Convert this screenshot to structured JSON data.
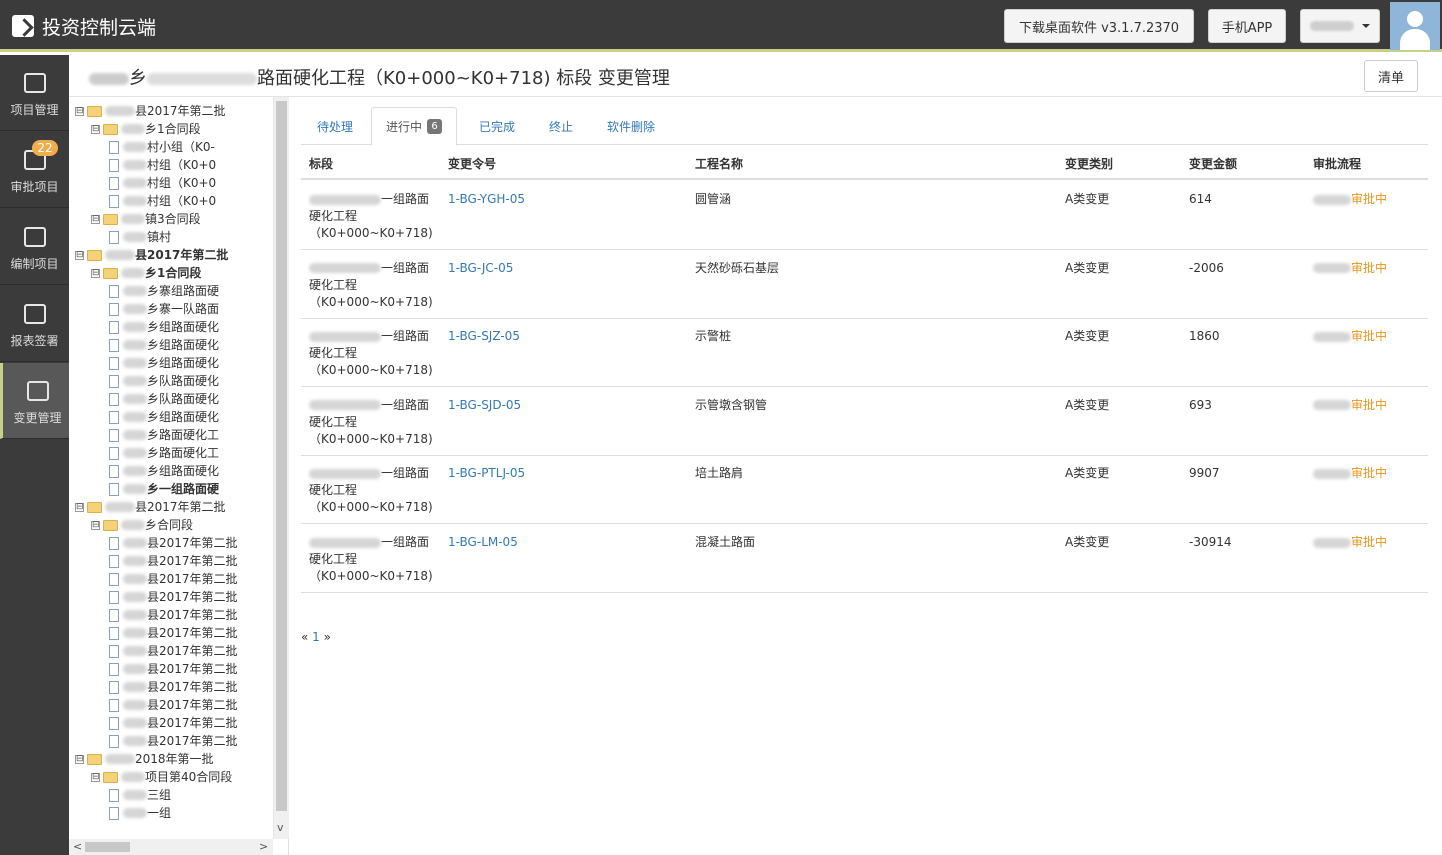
{
  "app": {
    "title": "投资控制云端",
    "download_label": "下载桌面软件 v3.1.7.2370",
    "mobile_label": "手机APP",
    "user_label": ""
  },
  "nav": [
    {
      "label": "项目管理",
      "icon": "inbox-icon"
    },
    {
      "label": "审批项目",
      "icon": "checklist-icon",
      "badge": "22"
    },
    {
      "label": "编制项目",
      "icon": "upload-tray-icon"
    },
    {
      "label": "报表签署",
      "icon": "printer-icon"
    },
    {
      "label": "变更管理",
      "icon": "clipboard-check-icon",
      "active": true
    }
  ],
  "header": {
    "title_prefix": "乡",
    "title_main": "路面硬化工程（K0+000~K0+718) 标段 变更管理",
    "list_button": "清单"
  },
  "tree": [
    {
      "depth": 0,
      "type": "folder",
      "toggle": "⊟",
      "text": "县2017年第二批",
      "bold": false
    },
    {
      "depth": 1,
      "type": "folder",
      "toggle": "⊟",
      "text": "乡1合同段",
      "bold": false
    },
    {
      "depth": 2,
      "type": "doc",
      "text": "村小组（K0-",
      "bold": false
    },
    {
      "depth": 2,
      "type": "doc",
      "text": "村组（K0+0",
      "bold": false
    },
    {
      "depth": 2,
      "type": "doc",
      "text": "村组（K0+0",
      "bold": false
    },
    {
      "depth": 2,
      "type": "doc",
      "text": "村组（K0+0",
      "bold": false
    },
    {
      "depth": 1,
      "type": "folder",
      "toggle": "⊟",
      "text": "镇3合同段",
      "bold": false
    },
    {
      "depth": 2,
      "type": "doc",
      "text": "镇村",
      "bold": false
    },
    {
      "depth": 0,
      "type": "folder",
      "toggle": "⊟",
      "text": "县2017年第二批",
      "bold": true
    },
    {
      "depth": 1,
      "type": "folder",
      "toggle": "⊟",
      "text": "乡1合同段",
      "bold": true
    },
    {
      "depth": 2,
      "type": "doc",
      "text": "乡寨组路面硬",
      "bold": false
    },
    {
      "depth": 2,
      "type": "doc",
      "text": "乡寨一队路面",
      "bold": false
    },
    {
      "depth": 2,
      "type": "doc",
      "text": "乡组路面硬化",
      "bold": false
    },
    {
      "depth": 2,
      "type": "doc",
      "text": "乡组路面硬化",
      "bold": false
    },
    {
      "depth": 2,
      "type": "doc",
      "text": "乡组路面硬化",
      "bold": false
    },
    {
      "depth": 2,
      "type": "doc",
      "text": "乡队路面硬化",
      "bold": false
    },
    {
      "depth": 2,
      "type": "doc",
      "text": "乡队路面硬化",
      "bold": false
    },
    {
      "depth": 2,
      "type": "doc",
      "text": "乡组路面硬化",
      "bold": false
    },
    {
      "depth": 2,
      "type": "doc",
      "text": "乡路面硬化工",
      "bold": false
    },
    {
      "depth": 2,
      "type": "doc",
      "text": "乡路面硬化工",
      "bold": false
    },
    {
      "depth": 2,
      "type": "doc",
      "text": "乡组路面硬化",
      "bold": false
    },
    {
      "depth": 2,
      "type": "doc",
      "text": "乡一组路面硬",
      "bold": true
    },
    {
      "depth": 0,
      "type": "folder",
      "toggle": "⊟",
      "text": "县2017年第二批",
      "bold": false
    },
    {
      "depth": 1,
      "type": "folder",
      "toggle": "⊟",
      "text": "乡合同段",
      "bold": false
    },
    {
      "depth": 2,
      "type": "doc",
      "text": "县2017年第二批",
      "bold": false
    },
    {
      "depth": 2,
      "type": "doc",
      "text": "县2017年第二批",
      "bold": false
    },
    {
      "depth": 2,
      "type": "doc",
      "text": "县2017年第二批",
      "bold": false
    },
    {
      "depth": 2,
      "type": "doc",
      "text": "县2017年第二批",
      "bold": false
    },
    {
      "depth": 2,
      "type": "doc",
      "text": "县2017年第二批",
      "bold": false
    },
    {
      "depth": 2,
      "type": "doc",
      "text": "县2017年第二批",
      "bold": false
    },
    {
      "depth": 2,
      "type": "doc",
      "text": "县2017年第二批",
      "bold": false
    },
    {
      "depth": 2,
      "type": "doc",
      "text": "县2017年第二批",
      "bold": false
    },
    {
      "depth": 2,
      "type": "doc",
      "text": "县2017年第二批",
      "bold": false
    },
    {
      "depth": 2,
      "type": "doc",
      "text": "县2017年第二批",
      "bold": false
    },
    {
      "depth": 2,
      "type": "doc",
      "text": "县2017年第二批",
      "bold": false
    },
    {
      "depth": 2,
      "type": "doc",
      "text": "县2017年第二批",
      "bold": false
    },
    {
      "depth": 0,
      "type": "folder",
      "toggle": "⊟",
      "text": "2018年第一批",
      "bold": false
    },
    {
      "depth": 1,
      "type": "folder",
      "toggle": "⊟",
      "text": "项目第40合同段",
      "bold": false
    },
    {
      "depth": 2,
      "type": "doc",
      "text": "三组",
      "bold": false
    },
    {
      "depth": 2,
      "type": "doc",
      "text": "一组",
      "bold": false
    }
  ],
  "tabs": [
    {
      "label": "待处理"
    },
    {
      "label": "进行中",
      "badge": "6",
      "active": true
    },
    {
      "label": "已完成"
    },
    {
      "label": "终止"
    },
    {
      "label": "软件删除"
    }
  ],
  "table": {
    "headers": [
      "标段",
      "变更令号",
      "工程名称",
      "变更类别",
      "变更金额",
      "审批流程"
    ],
    "rows": [
      {
        "section_line1": "一组路面",
        "section_line2": "硬化工程",
        "section_line3": "（K0+000~K0+718)",
        "order": "1-BG-YGH-05",
        "name": "圆管涵",
        "category": "A类变更",
        "amount": "614",
        "status": "审批中"
      },
      {
        "section_line1": "一组路面",
        "section_line2": "硬化工程",
        "section_line3": "（K0+000~K0+718)",
        "order": "1-BG-JC-05",
        "name": "天然砂砾石基层",
        "category": "A类变更",
        "amount": "-2006",
        "status": "审批中"
      },
      {
        "section_line1": "一组路面",
        "section_line2": "硬化工程",
        "section_line3": "（K0+000~K0+718)",
        "order": "1-BG-SJZ-05",
        "name": "示警桩",
        "category": "A类变更",
        "amount": "1860",
        "status": "审批中"
      },
      {
        "section_line1": "一组路面",
        "section_line2": "硬化工程",
        "section_line3": "（K0+000~K0+718)",
        "order": "1-BG-SJD-05",
        "name": "示管墩含钢管",
        "category": "A类变更",
        "amount": "693",
        "status": "审批中"
      },
      {
        "section_line1": "一组路面",
        "section_line2": "硬化工程",
        "section_line3": "（K0+000~K0+718)",
        "order": "1-BG-PTLJ-05",
        "name": "培土路肩",
        "category": "A类变更",
        "amount": "9907",
        "status": "审批中"
      },
      {
        "section_line1": "一组路面",
        "section_line2": "硬化工程",
        "section_line3": "（K0+000~K0+718)",
        "order": "1-BG-LM-05",
        "name": "混凝土路面",
        "category": "A类变更",
        "amount": "-30914",
        "status": "审批中"
      }
    ]
  },
  "pager": {
    "prev": "«",
    "page": "1",
    "next": "»"
  }
}
